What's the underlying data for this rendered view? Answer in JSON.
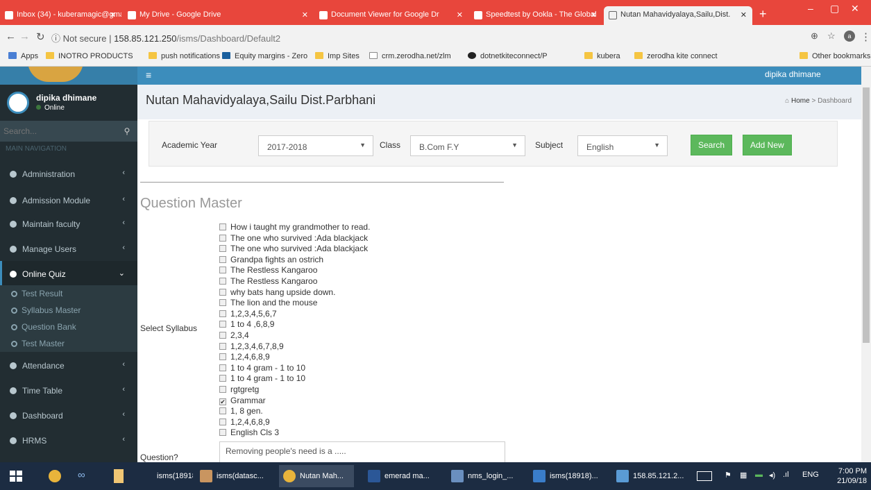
{
  "browser": {
    "tabs": [
      {
        "title": "Inbox (34) - kuberamagic@gma",
        "active": false
      },
      {
        "title": "My Drive - Google Drive",
        "active": false
      },
      {
        "title": "Document Viewer for Google Dr",
        "active": false
      },
      {
        "title": "Speedtest by Ookla - The Global",
        "active": false
      },
      {
        "title": "Nutan Mahavidyalaya,Sailu,Dist.",
        "active": true
      }
    ],
    "url_prefix": "Not secure",
    "url_host": "158.85.121.250",
    "url_path": "/isms/Dashboard/Default2",
    "bookmarks": [
      "Apps",
      "INOTRO PRODUCTS",
      "push notifications",
      "Equity margins - Zero",
      "Imp Sites",
      "crm.zerodha.net/zlm",
      "dotnetkiteconnect/P",
      "kubera",
      "zerodha kite connect",
      "Other bookmarks"
    ]
  },
  "sidebar": {
    "user_name": "dipika dhimane",
    "user_status": "Online",
    "search_placeholder": "Search...",
    "nav_header": "MAIN NAVIGATION",
    "items": [
      {
        "label": "Administration"
      },
      {
        "label": "Admission Module"
      },
      {
        "label": "Maintain faculty"
      },
      {
        "label": "Manage Users"
      },
      {
        "label": "Online Quiz"
      },
      {
        "label": "Attendance"
      },
      {
        "label": "Time Table"
      },
      {
        "label": "Dashboard"
      },
      {
        "label": "HRMS"
      }
    ],
    "sub_items": [
      "Test Result",
      "Syllabus Master",
      "Question Bank",
      "Test Master"
    ]
  },
  "topbar": {
    "user_name": "dipika dhimane"
  },
  "content": {
    "page_title": "Nutan Mahavidyalaya,Sailu Dist.Parbhani",
    "breadcrumb": {
      "home": "Home",
      "sep": ">",
      "current": "Dashboard"
    },
    "filter": {
      "academic_year_label": "Academic Year",
      "academic_year_value": "2017-2018",
      "class_label": "Class",
      "class_value": "B.Com F.Y",
      "subject_label": "Subject",
      "subject_value": "English",
      "search_label": "Search",
      "add_new_label": "Add New"
    },
    "section_title": "Question Master",
    "syllabus_label": "Select Syllabus",
    "syllabus": [
      {
        "label": "How i taught my grandmother to read.",
        "checked": false
      },
      {
        "label": "The one who survived :Ada blackjack",
        "checked": false
      },
      {
        "label": "The one who survived :Ada blackjack",
        "checked": false
      },
      {
        "label": "Grandpa fights an ostrich",
        "checked": false
      },
      {
        "label": "The Restless Kangaroo",
        "checked": false
      },
      {
        "label": "The Restless Kangaroo",
        "checked": false
      },
      {
        "label": "why bats hang upside down.",
        "checked": false
      },
      {
        "label": "The lion and the mouse",
        "checked": false
      },
      {
        "label": "1,2,3,4,5,6,7",
        "checked": false
      },
      {
        "label": "1 to 4 ,6,8,9",
        "checked": false
      },
      {
        "label": "2,3,4",
        "checked": false
      },
      {
        "label": "1,2,3,4,6,7,8,9",
        "checked": false
      },
      {
        "label": "1,2,4,6,8,9",
        "checked": false
      },
      {
        "label": "1 to 4 gram - 1 to 10",
        "checked": false
      },
      {
        "label": "1 to 4 gram - 1 to 10",
        "checked": false
      },
      {
        "label": "rgtgretg",
        "checked": false
      },
      {
        "label": "Grammar",
        "checked": true
      },
      {
        "label": "1, 8 gen.",
        "checked": false
      },
      {
        "label": "1,2,4,6,8,9",
        "checked": false
      },
      {
        "label": "English Cls 3",
        "checked": false
      }
    ],
    "question_label": "Question?",
    "question_value": "Removing people's need is a ....."
  },
  "taskbar": {
    "items": [
      "isms(18918)",
      "isms(datasc...",
      "Nutan Mah...",
      "emerad ma...",
      "nms_login_...",
      "isms(18918)...",
      "158.85.121.2..."
    ],
    "lang": "ENG",
    "time": "7:00 PM",
    "date": "21/09/18"
  }
}
